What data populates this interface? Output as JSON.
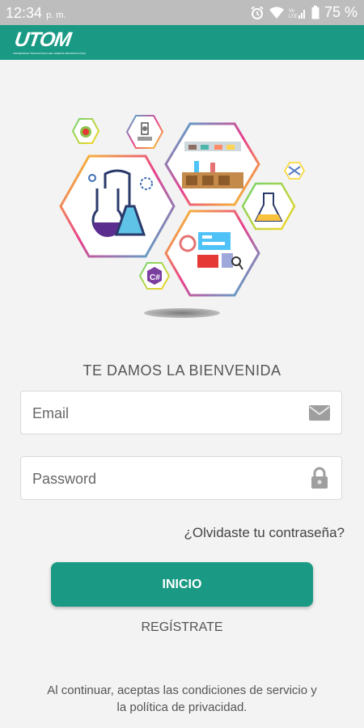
{
  "status_bar": {
    "time": "12:34",
    "ampm": "p. m.",
    "battery": "75 %"
  },
  "app_bar": {
    "logo_text": "UTOM",
    "logo_tagline": "UNIVERSIDAD TECNOLÓGICA DEL ORIENTE METROPOLITANO"
  },
  "illustration": {
    "icons": [
      "apple-icon",
      "microscope-icon",
      "laboratory-icon",
      "flasks-icon",
      "flask-icon",
      "dashboard-icon",
      "csharp-icon",
      "satellite-icon"
    ],
    "csharp_letter": "C#"
  },
  "welcome": "TE DAMOS LA BIENVENIDA",
  "email": {
    "placeholder": "Email",
    "value": ""
  },
  "password": {
    "placeholder": "Password",
    "value": ""
  },
  "forgot_password": "¿Olvidaste tu contraseña?",
  "login_button": "INICIO",
  "register_link": "REGÍSTRATE",
  "terms": "Al continuar, aceptas las condiciones de servicio y la política de privacidad.",
  "colors": {
    "primary": "#1a9a84",
    "status_bar": "#bdbdbd",
    "background": "#f3f3f3"
  }
}
